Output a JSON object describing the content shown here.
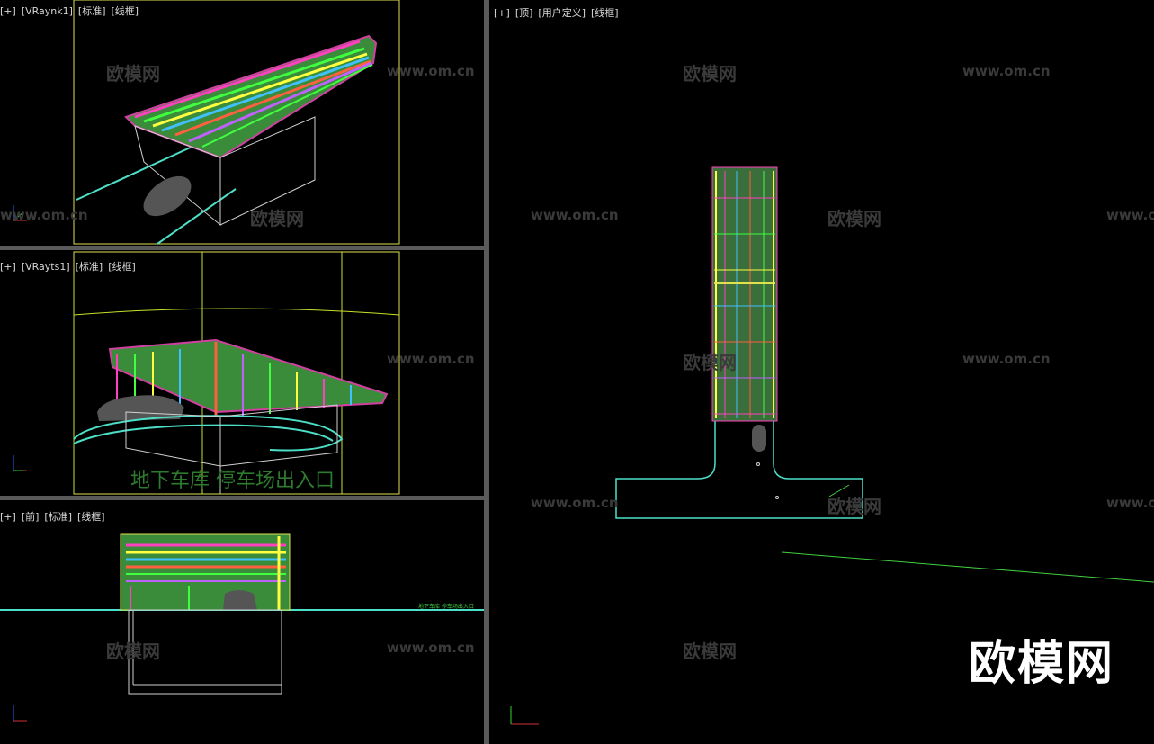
{
  "viewports": {
    "top_left": {
      "labels": [
        "[+]",
        "[VRaynk1]",
        "[标准]",
        "[线框]"
      ]
    },
    "mid_left": {
      "labels": [
        "[+]",
        "[VRayts1]",
        "[标准]",
        "[线框]"
      ],
      "caption": "地下车库 停车场出入口"
    },
    "bottom_left": {
      "labels": [
        "[+]",
        "[前]",
        "[标准]",
        "[线框]"
      ],
      "small_caption": "地下车库 停车场出入口"
    },
    "right": {
      "labels": [
        "[+]",
        "[顶]",
        "[用户定义]",
        "[线框]"
      ]
    }
  },
  "watermarks": {
    "brand": "欧模网",
    "url": "www.om.cn",
    "big": "欧模网"
  },
  "axis": {
    "x": "x",
    "y": "y",
    "z": "z"
  },
  "colors": {
    "grid": "#c8e02a",
    "ground": "#4de0c8",
    "frame": "#e0e050",
    "car": "#555555",
    "divider": "#5a5a5a"
  }
}
